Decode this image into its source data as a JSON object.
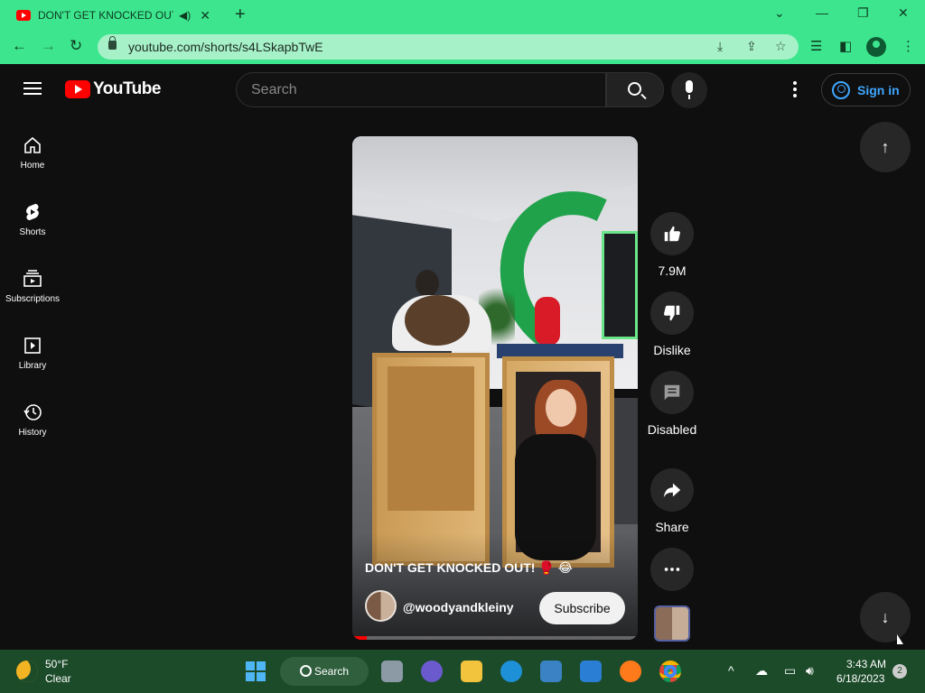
{
  "browser": {
    "tab_title": "DON'T GET KNOCKED OUT!",
    "url": "youtube.com/shorts/s4LSkapbTwE"
  },
  "youtube": {
    "logo_text": "YouTube",
    "search_placeholder": "Search",
    "signin_label": "Sign in",
    "sidebar": [
      {
        "label": "Home",
        "icon": "home-icon"
      },
      {
        "label": "Shorts",
        "icon": "shorts-icon"
      },
      {
        "label": "Subscriptions",
        "icon": "subscriptions-icon"
      },
      {
        "label": "Library",
        "icon": "library-icon"
      },
      {
        "label": "History",
        "icon": "history-icon"
      }
    ],
    "short": {
      "title": "DON'T GET KNOCKED OUT! 🥊 😂",
      "channel": "@woodyandkleiny",
      "subscribe_label": "Subscribe",
      "progress_fraction": 0.05
    },
    "actions": {
      "likes": "7.9M",
      "dislike_label": "Dislike",
      "comments_label": "Disabled",
      "share_label": "Share"
    }
  },
  "taskbar": {
    "weather_temp": "50°F",
    "weather_condition": "Clear",
    "search_label": "Search",
    "time": "3:43 AM",
    "date": "6/18/2023",
    "notification_count": "2"
  },
  "colors": {
    "chrome_green": "#3de68e",
    "youtube_red": "#ff0000",
    "signin_blue": "#3ea6ff",
    "taskbar": "#1c4b2a"
  }
}
